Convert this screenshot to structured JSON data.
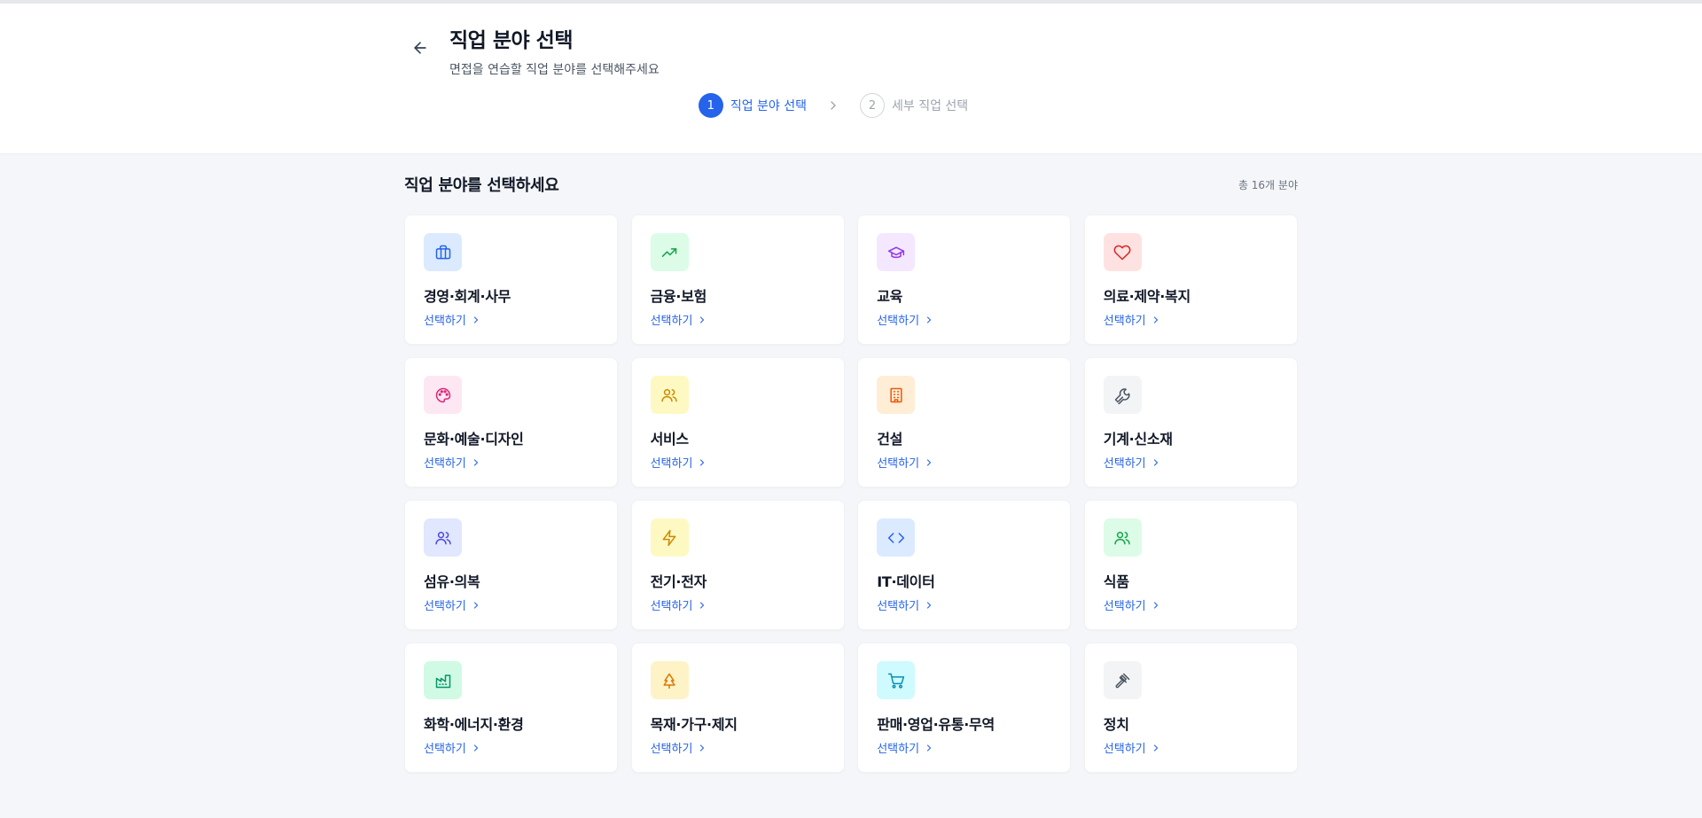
{
  "header": {
    "title": "직업 분야 선택",
    "subtitle": "면접을 연습할 직업 분야를 선택해주세요",
    "back_icon": "arrow-left-icon"
  },
  "stepper": {
    "steps": [
      {
        "number": "1",
        "label": "직업 분야 선택",
        "state": "active"
      },
      {
        "number": "2",
        "label": "세부 직업 선택",
        "state": "inactive"
      }
    ],
    "separator_icon": "chevron-right-icon"
  },
  "section": {
    "title": "직업 분야를 선택하세요",
    "count": "총 16개 분야"
  },
  "categories": [
    {
      "name": "경영·회계·사무",
      "link": "선택하기",
      "icon": "briefcase-icon",
      "bg": "#dbeafe",
      "fg": "#2563eb"
    },
    {
      "name": "금융·보험",
      "link": "선택하기",
      "icon": "trending-up-icon",
      "bg": "#dcfce7",
      "fg": "#16a34a"
    },
    {
      "name": "교육",
      "link": "선택하기",
      "icon": "graduation-cap-icon",
      "bg": "#f3e8ff",
      "fg": "#9333ea"
    },
    {
      "name": "의료·제약·복지",
      "link": "선택하기",
      "icon": "heart-icon",
      "bg": "#fee2e2",
      "fg": "#dc2626"
    },
    {
      "name": "문화·예술·디자인",
      "link": "선택하기",
      "icon": "palette-icon",
      "bg": "#fce7f3",
      "fg": "#db2777"
    },
    {
      "name": "서비스",
      "link": "선택하기",
      "icon": "users-icon",
      "bg": "#fef9c3",
      "fg": "#ca8a04"
    },
    {
      "name": "건설",
      "link": "선택하기",
      "icon": "building-icon",
      "bg": "#ffedd5",
      "fg": "#ea580c"
    },
    {
      "name": "기계·신소재",
      "link": "선택하기",
      "icon": "wrench-icon",
      "bg": "#f3f4f6",
      "fg": "#4b5563"
    },
    {
      "name": "섬유·의복",
      "link": "선택하기",
      "icon": "users-icon",
      "bg": "#e0e7ff",
      "fg": "#4f46e5"
    },
    {
      "name": "전기·전자",
      "link": "선택하기",
      "icon": "zap-icon",
      "bg": "#fef9c3",
      "fg": "#ca8a04"
    },
    {
      "name": "IT·데이터",
      "link": "선택하기",
      "icon": "code-icon",
      "bg": "#dbeafe",
      "fg": "#2563eb"
    },
    {
      "name": "식품",
      "link": "선택하기",
      "icon": "users-icon",
      "bg": "#dcfce7",
      "fg": "#16a34a"
    },
    {
      "name": "화학·에너지·환경",
      "link": "선택하기",
      "icon": "factory-icon",
      "bg": "#d1fae5",
      "fg": "#059669"
    },
    {
      "name": "목재·가구·제지",
      "link": "선택하기",
      "icon": "tree-icon",
      "bg": "#fef3c7",
      "fg": "#d97706"
    },
    {
      "name": "판매·영업·유통·무역",
      "link": "선택하기",
      "icon": "shopping-cart-icon",
      "bg": "#cffafe",
      "fg": "#0891b2"
    },
    {
      "name": "정치",
      "link": "선택하기",
      "icon": "gavel-icon",
      "bg": "#f3f4f6",
      "fg": "#4b5563"
    }
  ]
}
